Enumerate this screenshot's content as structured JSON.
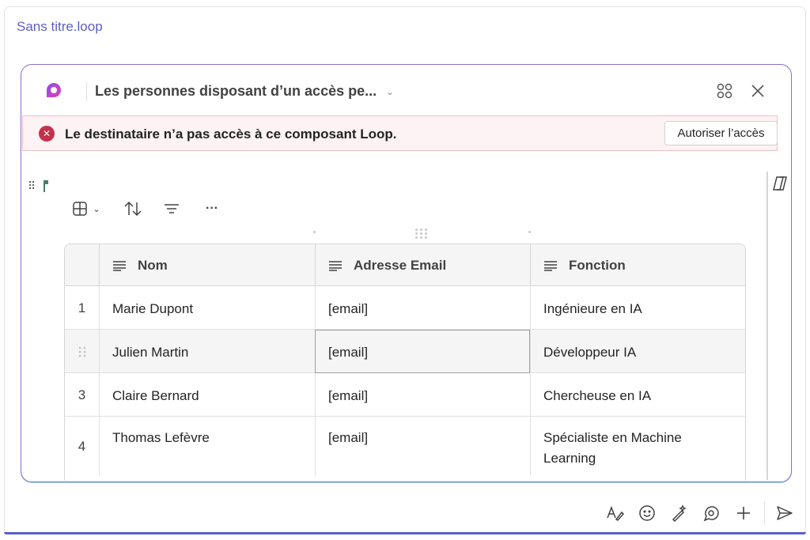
{
  "attachment": {
    "name": "Sans titre.loop"
  },
  "card": {
    "title": "Les personnes disposant d’un accès pe...",
    "apps_icon": "apps-grid-icon",
    "close_icon": "close-icon"
  },
  "alert": {
    "message": "Le destinataire n’a pas accès à ce composant Loop.",
    "button_label": "Autoriser l’accès",
    "color": "#c4314b"
  },
  "toolbar": {
    "items": [
      "table-view-icon",
      "chevron-down-icon",
      "sort-icon",
      "filter-icon",
      "more-icon"
    ],
    "more_label": "···"
  },
  "table": {
    "columns": [
      "Nom",
      "Adresse Email",
      "Fonction"
    ],
    "rows": [
      {
        "num": "1",
        "nom": "Marie Dupont",
        "email": "[email]",
        "fonction": "Ingénieure en IA"
      },
      {
        "num": "",
        "nom": "Julien Martin",
        "email": "[email]",
        "fonction": "Développeur IA"
      },
      {
        "num": "3",
        "nom": "Claire Bernard",
        "email": "[email]",
        "fonction": "Chercheuse en IA"
      },
      {
        "num": "4",
        "nom": "Thomas Lefèvre",
        "email": "[email]",
        "fonction": "Spécialiste en Machine Learning"
      }
    ]
  },
  "compose_toolbar": {
    "items": [
      "format-icon",
      "emoji-icon",
      "copilot-pen-icon",
      "loop-icon",
      "add-icon",
      "send-icon"
    ]
  },
  "colors": {
    "accent": "#5b5fc7",
    "card_border": "#8b6cd6"
  }
}
